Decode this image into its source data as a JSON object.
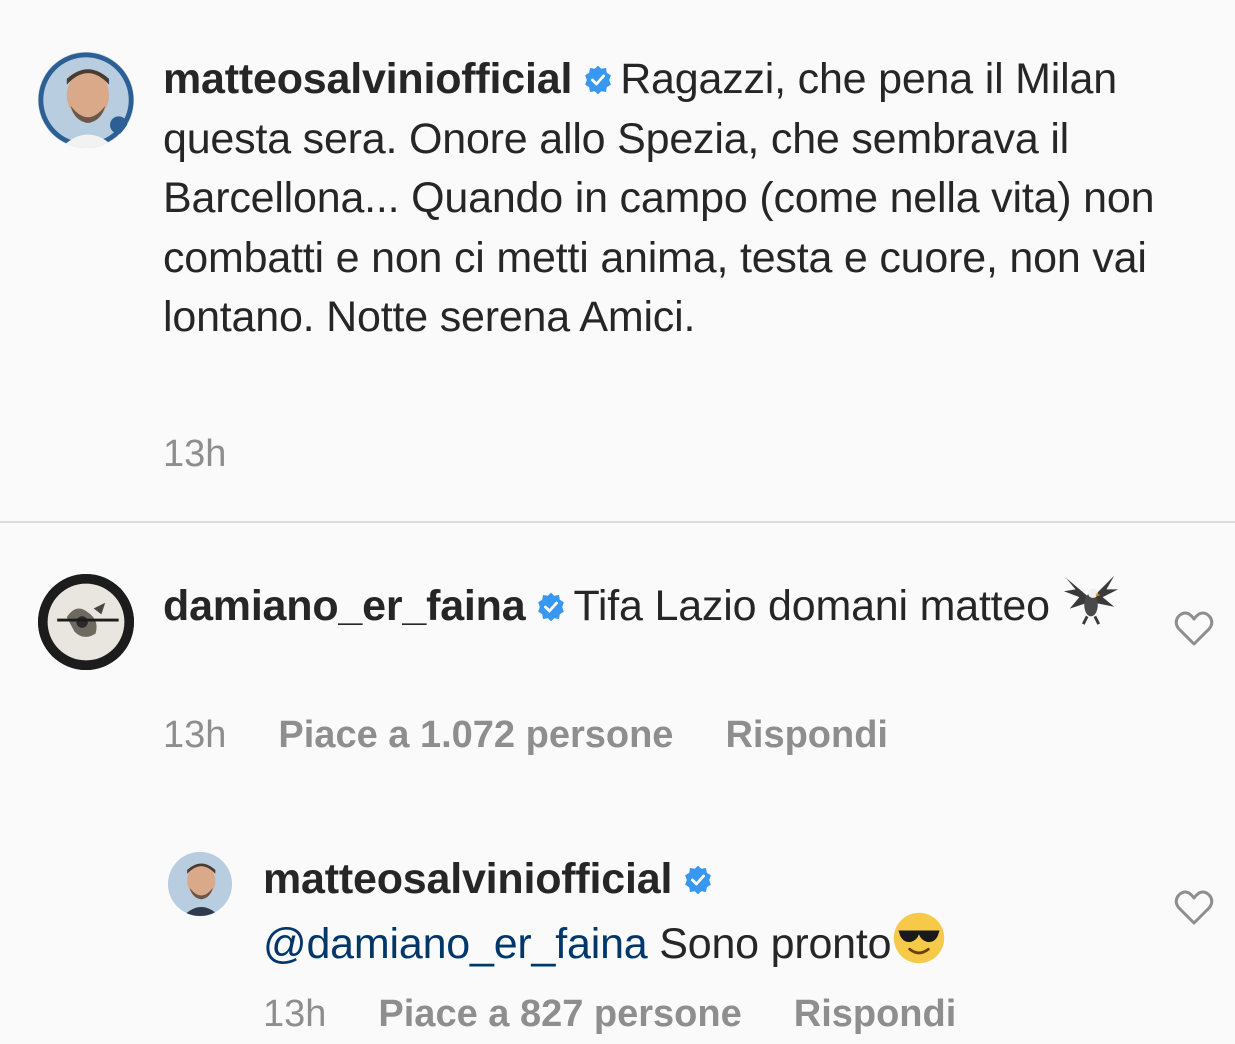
{
  "caption": {
    "username": "matteosalviniofficial",
    "text": "Ragazzi, che pena il Milan questa sera. Onore allo Spezia, che sembrava il Barcellona... Quando in campo (come nella vita) non combatti e non ci metti anima, testa e cuore, non vai lontano. Notte serena Amici.",
    "time": "13h"
  },
  "comments": [
    {
      "username": "damiano_er_faina",
      "text": "Tifa Lazio domani matteo",
      "emoji": "eagle-icon",
      "time": "13h",
      "likes": "Piace a 1.072 persone",
      "reply": "Rispondi"
    },
    {
      "username": "matteosalviniofficial",
      "mention": "@damiano_er_faina",
      "text": " Sono pronto",
      "emoji": "sunglasses-emoji",
      "time": "13h",
      "likes": "Piace a 827 persone",
      "reply": "Rispondi"
    }
  ],
  "colors": {
    "text": "#262626",
    "meta": "#8e8e8e",
    "verified": "#3897f0",
    "mention": "#00376b",
    "background": "#fafafa"
  }
}
